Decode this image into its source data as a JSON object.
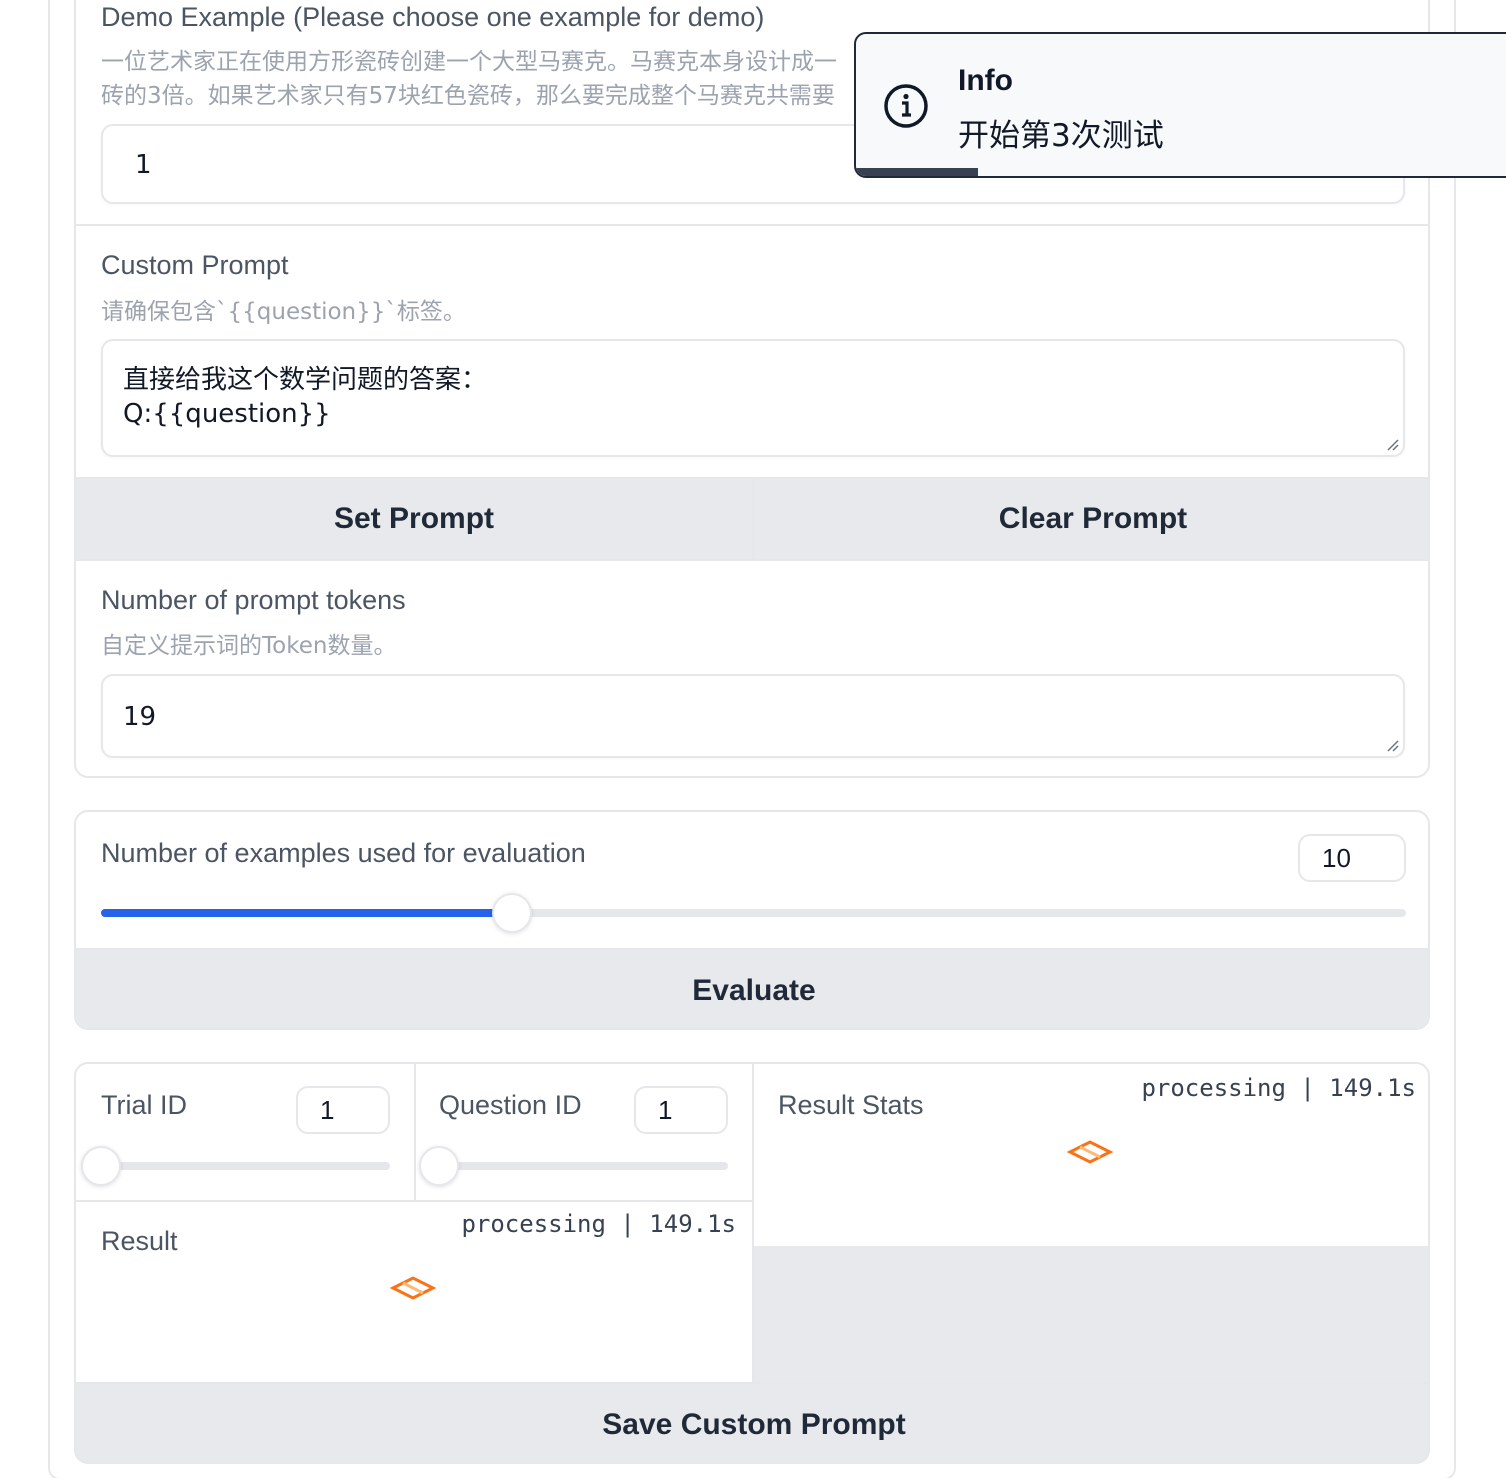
{
  "demo_example": {
    "label": "Demo Example (Please choose one example for demo)",
    "info_line1": "一位艺术家正在使用方形瓷砖创建一个大型马赛克。马赛克本身设计成一",
    "info_line2": "砖的3倍。如果艺术家只有57块红色瓷砖，那么要完成整个马赛克共需要",
    "value": "1"
  },
  "custom_prompt": {
    "label": "Custom Prompt",
    "info": "请确保包含`{{question}}`标签。",
    "value_line1": "直接给我这个数学问题的答案：",
    "value_line2": "Q:{{question}}"
  },
  "buttons": {
    "set_prompt": "Set Prompt",
    "clear_prompt": "Clear Prompt",
    "evaluate": "Evaluate",
    "save_custom_prompt": "Save Custom Prompt"
  },
  "prompt_tokens": {
    "label": "Number of prompt tokens",
    "info": "自定义提示词的Token数量。",
    "value": "19"
  },
  "eval_examples": {
    "label": "Number of examples used for evaluation",
    "value": "10",
    "slider_fraction": 0.315
  },
  "trial_id": {
    "label": "Trial ID",
    "value": "1",
    "slider_fraction": 0.0
  },
  "question_id": {
    "label": "Question ID",
    "value": "1",
    "slider_fraction": 0.0
  },
  "result_stats": {
    "label": "Result Stats",
    "status": "processing | 149.1s"
  },
  "result": {
    "label": "Result",
    "status": "processing | 149.1s"
  },
  "toast": {
    "title": "Info",
    "message": "开始第3次测试",
    "icon": "info-icon",
    "progress_fraction": 0.18
  },
  "colors": {
    "accent": "#2563eb",
    "loader": "#f97316",
    "button_bg": "#e8e9ed",
    "border": "#e5e7eb"
  }
}
